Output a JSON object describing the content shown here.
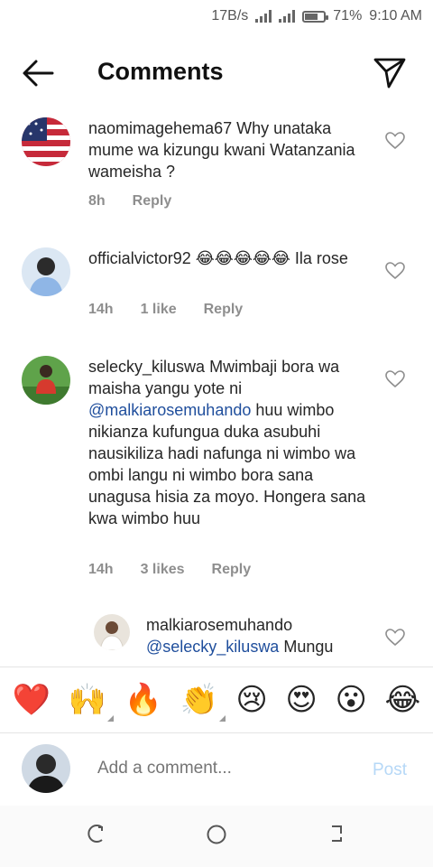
{
  "status": {
    "speed": "17B/s",
    "battery": "71%",
    "time": "9:10 AM",
    "battery_level": 0.71
  },
  "header": {
    "title": "Comments",
    "back_icon": "arrow-left-icon",
    "send_icon": "send-icon"
  },
  "comments": [
    {
      "username": "naomimagehema67",
      "text": "Why unataka mume wa kizungu kwani Watanzania wameisha ?",
      "time": "8h",
      "likes": "",
      "reply": "Reply"
    },
    {
      "username": "officialvictor92",
      "text": "😂😂😂😂😂 Ila rose",
      "time": "14h",
      "likes": "1 like",
      "reply": "Reply"
    },
    {
      "username": "selecky_kiluswa",
      "text_before": "Mwimbaji bora wa maisha yangu yote ni",
      "mention": "@malkiarosemuhando",
      "text_after": " huu wimbo nikianza kufungua duka asubuhi nausikiliza hadi nafunga ni wimbo wa ombi langu ni wimbo bora sana unagusa hisia za moyo. Hongera sana kwa wimbo huu",
      "time": "14h",
      "likes": "3 likes",
      "reply": "Reply"
    },
    {
      "username": "malkiarosemuhando",
      "mention": "@selecky_kiluswa",
      "text": " Mungu"
    }
  ],
  "reactions": [
    "❤️",
    "🙌",
    "🔥",
    "👏",
    "😢",
    "😍",
    "😮",
    "😂"
  ],
  "composer": {
    "placeholder": "Add a comment...",
    "post_label": "Post"
  },
  "colors": {
    "mention": "#1f4e9c",
    "post_disabled": "#b6d8f7",
    "meta": "#8e8e8e"
  }
}
